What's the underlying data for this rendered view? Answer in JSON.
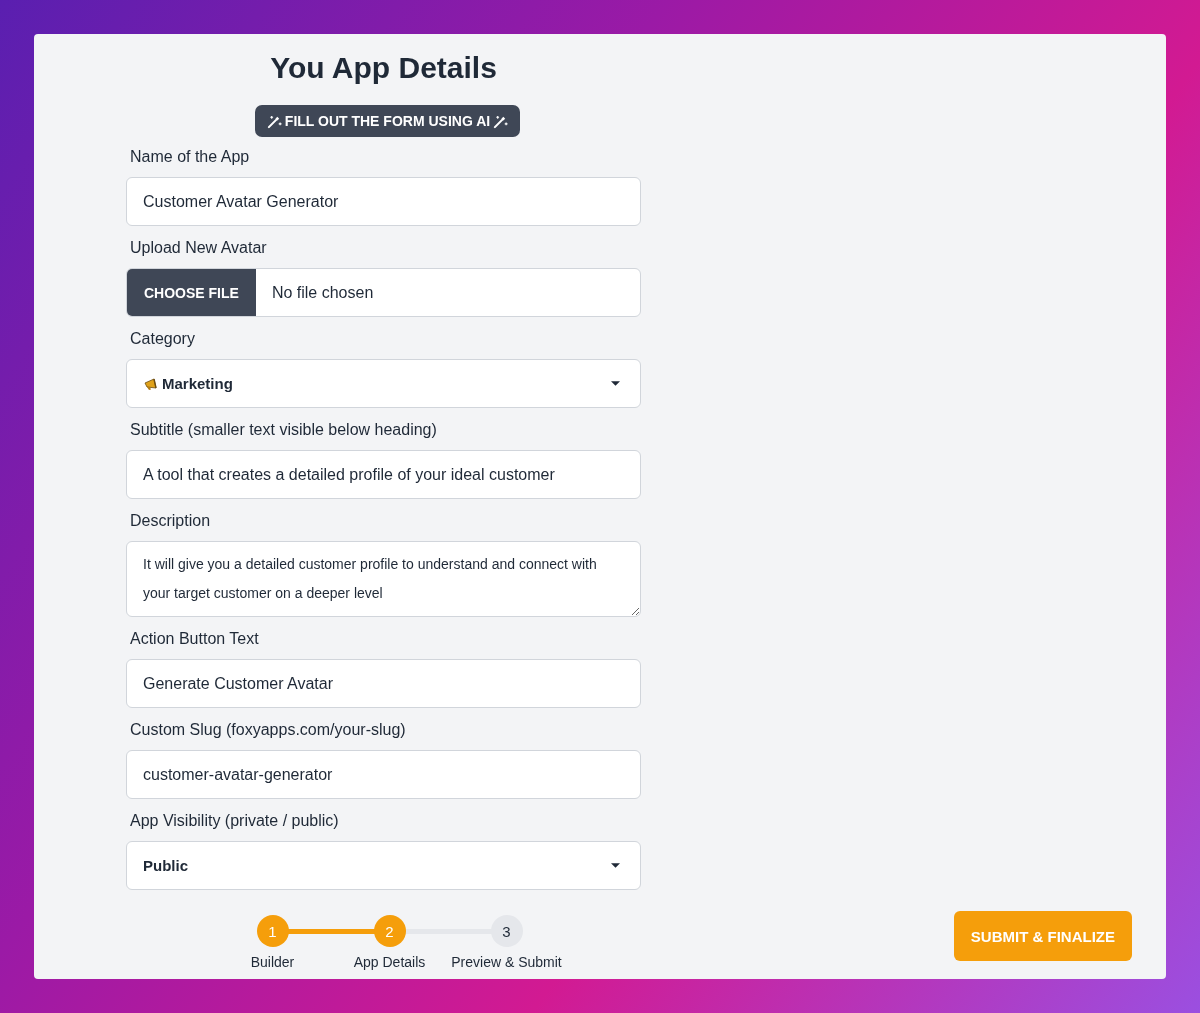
{
  "title": "You App Details",
  "ai_button": {
    "label": "FILL OUT THE FORM USING AI"
  },
  "fields": [
    {
      "kind": "text",
      "label": "Name of the App",
      "value": "Customer Avatar Generator"
    },
    {
      "kind": "file",
      "label": "Upload New Avatar",
      "button": "CHOOSE FILE",
      "value": "No file chosen"
    },
    {
      "kind": "iconselect",
      "label": "Category",
      "value": "Marketing"
    },
    {
      "kind": "text",
      "label": "Subtitle (smaller text visible below heading)",
      "value": "A tool that creates a detailed profile of your ideal customer"
    },
    {
      "kind": "textarea",
      "label": "Description",
      "value": "It will give you a detailed customer profile to understand and connect with your target customer on a deeper level"
    },
    {
      "kind": "text",
      "label": "Action Button Text",
      "value": "Generate Customer Avatar"
    },
    {
      "kind": "text",
      "label": "Custom Slug (foxyapps.com/your-slug)",
      "value": "customer-avatar-generator"
    },
    {
      "kind": "select",
      "label": "App Visibility (private / public)",
      "value": "Public"
    }
  ],
  "steps": [
    {
      "number": "1",
      "label": "Builder",
      "completed": true
    },
    {
      "number": "2",
      "label": "App Details",
      "completed": true
    },
    {
      "number": "3",
      "label": "Preview & Submit",
      "completed": false
    }
  ],
  "submit_button": {
    "label": "SUBMIT & FINALIZE"
  }
}
